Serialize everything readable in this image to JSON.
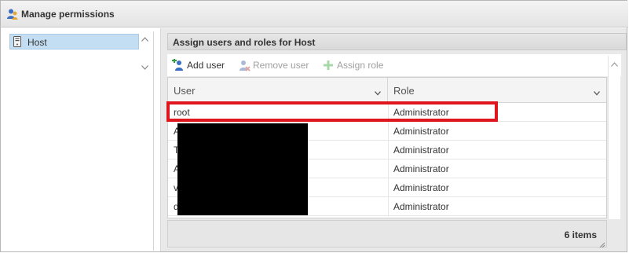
{
  "window": {
    "title": "Manage permissions",
    "title_icon": "users-icon"
  },
  "tree": {
    "items": [
      {
        "label": "Host",
        "icon": "host-icon",
        "selected": true
      }
    ]
  },
  "panel": {
    "header": "Assign users and roles for Host",
    "toolbar": {
      "add_user": "Add user",
      "remove_user": "Remove user",
      "assign_role": "Assign role"
    },
    "columns": [
      "User",
      "Role"
    ],
    "rows": [
      {
        "user": "root",
        "role": "Administrator"
      },
      {
        "user": "A",
        "role": "Administrator"
      },
      {
        "user": "T",
        "role": "Administrator"
      },
      {
        "user": "A",
        "role": "Administrator"
      },
      {
        "user": "vp",
        "role": "Administrator"
      },
      {
        "user": "d",
        "role": "Administrator"
      }
    ],
    "item_count": "6 items"
  },
  "colors": {
    "highlight": "#e0161e",
    "selection": "#c3ddf3",
    "redaction": "#000000"
  }
}
